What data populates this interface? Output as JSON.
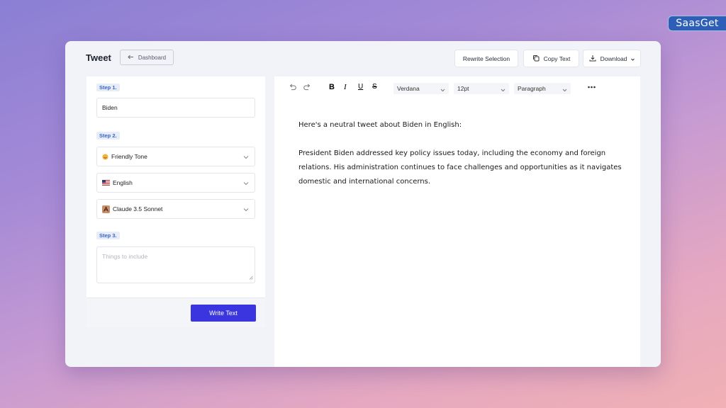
{
  "brand": "SaasGet",
  "header": {
    "title": "Tweet",
    "back_label": "Dashboard",
    "rewrite_label": "Rewrite Selection",
    "copy_label": "Copy Text",
    "download_label": "Download"
  },
  "form": {
    "step1": "Step 1.",
    "topic_value": "Biden",
    "step2": "Step 2.",
    "tone": "Friendly Tone",
    "language": "English",
    "model": "Claude 3.5 Sonnet",
    "step3": "Step 3.",
    "details_placeholder": "Things to include",
    "write_label": "Write Text"
  },
  "toolbar": {
    "font": "Verdana",
    "size": "12pt",
    "block": "Paragraph",
    "icons": [
      "undo-icon",
      "redo-icon",
      "bold-icon",
      "italic-icon",
      "underline-icon",
      "strikethrough-icon",
      "more-icon"
    ]
  },
  "document": {
    "para1": "Here's a neutral tweet about Biden in English:",
    "para2": "President Biden addressed key policy issues today, including the economy and foreign relations. His administration continues to face challenges and opportunities as it navigates domestic and international concerns."
  },
  "colors": {
    "accent": "#3b35e0",
    "step_label": "#3a66c8",
    "brand_badge": "#2d5fb8"
  }
}
